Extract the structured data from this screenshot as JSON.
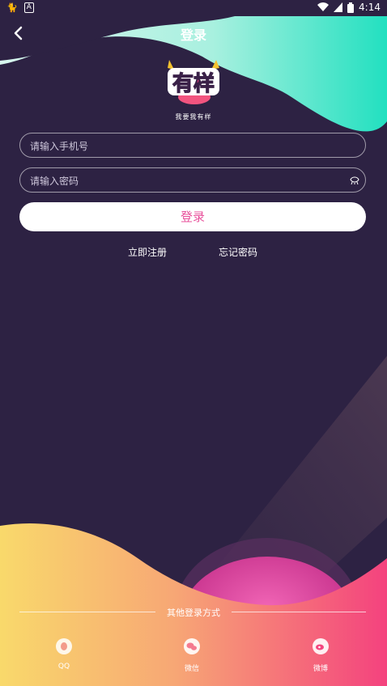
{
  "status_bar": {
    "time": "4:14",
    "left_icons": [
      "cat-icon",
      "a-icon"
    ],
    "right_icons": [
      "wifi-icon",
      "signal-icon",
      "battery-icon"
    ]
  },
  "header": {
    "title": "登录",
    "back_icon": "chevron-left-icon"
  },
  "brand": {
    "logo_text": "有样",
    "slogan": "我要我有样"
  },
  "form": {
    "phone_placeholder": "请输入手机号",
    "password_placeholder": "请输入密码",
    "password_toggle_icon": "eye-icon",
    "login_label": "登录"
  },
  "links": {
    "register": "立即注册",
    "forgot": "忘记密码"
  },
  "other_login": {
    "title": "其他登录方式",
    "options": [
      {
        "label": "QQ",
        "icon": "qq-icon"
      },
      {
        "label": "微信",
        "icon": "wechat-icon"
      },
      {
        "label": "微博",
        "icon": "weibo-icon"
      }
    ]
  },
  "colors": {
    "background": "#2d2243",
    "accent": "#e8509b",
    "teal": "#2fe3c3",
    "pink": "#f0407f",
    "orange": "#f7b06a"
  }
}
